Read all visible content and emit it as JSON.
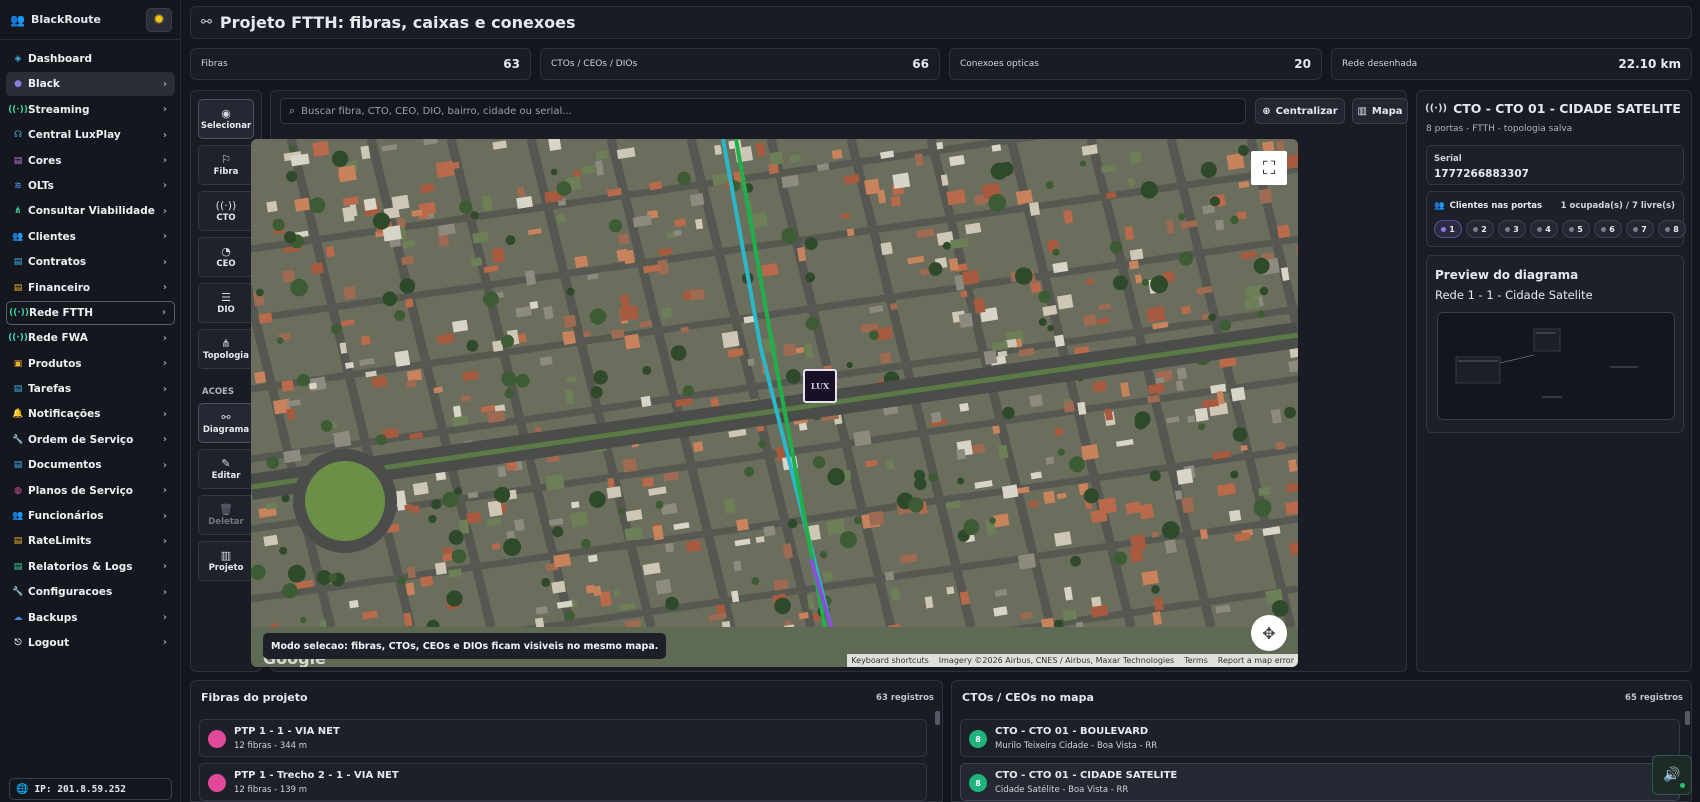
{
  "brand": {
    "name": "BlackRoute"
  },
  "sidebar": {
    "items": [
      {
        "label": "Dashboard",
        "color": "#3fb6e8",
        "chev": ""
      },
      {
        "label": "Black",
        "color": "#8b7be0",
        "chev": "›"
      },
      {
        "label": "Streaming",
        "color": "#3fd0a0",
        "chev": "›"
      },
      {
        "label": "Central LuxPlay",
        "color": "#3fb6e8",
        "chev": "›"
      },
      {
        "label": "Cores",
        "color": "#c07be0",
        "chev": "›"
      },
      {
        "label": "OLTs",
        "color": "#3f8be8",
        "chev": "›"
      },
      {
        "label": "Consultar Viabilidade",
        "color": "#3fd0a0",
        "chev": "›"
      },
      {
        "label": "Clientes",
        "color": "#3fd0a0",
        "chev": "›"
      },
      {
        "label": "Contratos",
        "color": "#3fb6e8",
        "chev": "›"
      },
      {
        "label": "Financeiro",
        "color": "#f0b030",
        "chev": "›"
      },
      {
        "label": "Rede FTTH",
        "color": "#3fd0a0",
        "chev": "›"
      },
      {
        "label": "Rede FWA",
        "color": "#3fd0c0",
        "chev": "›"
      },
      {
        "label": "Produtos",
        "color": "#f0b030",
        "chev": "›"
      },
      {
        "label": "Tarefas",
        "color": "#3fb6e8",
        "chev": "›"
      },
      {
        "label": "Notificações",
        "color": "#f05050",
        "chev": "›"
      },
      {
        "label": "Ordem de Serviço",
        "color": "#f0b030",
        "chev": "›"
      },
      {
        "label": "Documentos",
        "color": "#3fb6e8",
        "chev": "›"
      },
      {
        "label": "Planos de Serviço",
        "color": "#e050a0",
        "chev": "›"
      },
      {
        "label": "Funcionários",
        "color": "#3fd0a0",
        "chev": "›"
      },
      {
        "label": "RateLimits",
        "color": "#f0b030",
        "chev": "›"
      },
      {
        "label": "Relatorios & Logs",
        "color": "#3fd0a0",
        "chev": "›"
      },
      {
        "label": "Configuracoes",
        "color": "#3fb6e8",
        "chev": "›"
      },
      {
        "label": "Backups",
        "color": "#3f8be8",
        "chev": "›"
      },
      {
        "label": "Logout",
        "color": "#e6e8ee",
        "chev": "›"
      }
    ],
    "ip": "IP: 201.8.59.252"
  },
  "header": {
    "title": "Projeto FTTH: fibras, caixas e conexoes"
  },
  "stats": [
    {
      "label": "Fibras",
      "value": "63"
    },
    {
      "label": "CTOs / CEOs / DIOs",
      "value": "66"
    },
    {
      "label": "Conexoes opticas",
      "value": "20"
    },
    {
      "label": "Rede desenhada",
      "value": "22.10 km"
    }
  ],
  "tools": {
    "selecionar": "Selecionar",
    "fibra": "Fibra",
    "cto": "CTO",
    "ceo": "CEO",
    "dio": "DIO",
    "topologia": "Topologia",
    "acoes": "ACOES",
    "diagrama": "Diagrama",
    "editar": "Editar",
    "deletar": "Deletar",
    "projeto": "Projeto"
  },
  "search": {
    "placeholder": "Buscar fibra, CTO, CEO, DIO, bairro, cidade ou serial..."
  },
  "buttons": {
    "centralizar": "Centralizar",
    "mapa": "Mapa"
  },
  "map": {
    "mode_text": "Modo selecao: fibras, CTOs, CEOs e DIOs ficam visiveis no mesmo mapa.",
    "google": "Google",
    "marker": "LUX",
    "attrib": [
      "Keyboard shortcuts",
      "Imagery ©2026 Airbus, CNES / Airbus, Maxar Technologies",
      "Terms",
      "Report a map error"
    ]
  },
  "detail": {
    "title": "CTO - CTO 01 - CIDADE SATELITE",
    "subtitle": "8 portas - FTTH - topologia salva",
    "serial_label": "Serial",
    "serial_value": "1777266883307",
    "clients_label": "Clientes nas portas",
    "clients_status": "1 ocupada(s) / 7 livre(s)",
    "ports": [
      "1",
      "2",
      "3",
      "4",
      "5",
      "6",
      "7",
      "8"
    ],
    "preview_title": "Preview do diagrama",
    "preview_subtitle": "Rede 1 - 1 - Cidade Satelite"
  },
  "fibers": {
    "title": "Fibras do projeto",
    "count": "63 registros",
    "items": [
      {
        "name": "PTP 1 - 1 - VIA NET",
        "info": "12 fibras - 344 m",
        "color": "#e0489a"
      },
      {
        "name": "PTP 1 - Trecho 2 - 1 - VIA NET",
        "info": "12 fibras - 139 m",
        "color": "#e0489a"
      }
    ]
  },
  "ctos": {
    "title": "CTOs / CEOs no mapa",
    "count": "65 registros",
    "items": [
      {
        "name": "CTO - CTO 01 - BOULEVARD",
        "info": "Murilo Teixeira Cidade - Boa Vista - RR",
        "badge": "8"
      },
      {
        "name": "CTO - CTO 01 - CIDADE SATELITE",
        "info": "Cidade Satélite - Boa Vista - RR",
        "badge": "8"
      }
    ]
  }
}
